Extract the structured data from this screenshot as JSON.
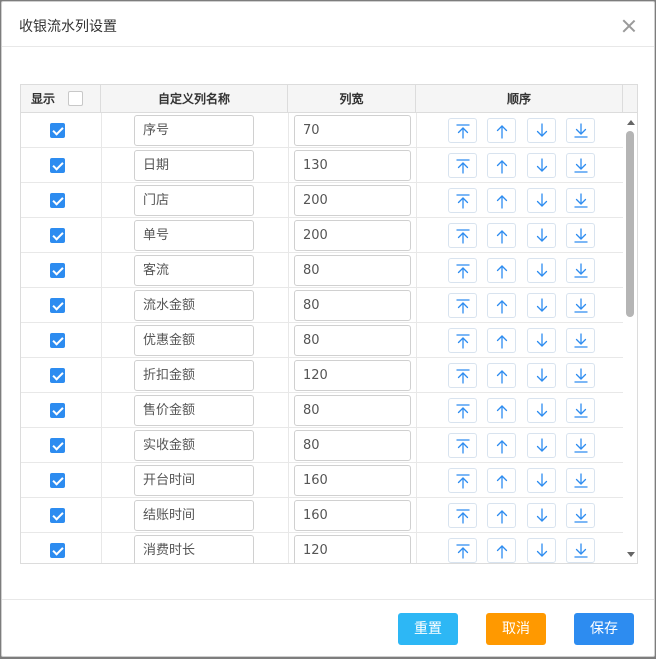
{
  "dialog": {
    "title": "收银流水列设置"
  },
  "table": {
    "headers": {
      "show": "显示",
      "name": "自定义列名称",
      "width": "列宽",
      "order": "顺序"
    },
    "rows": [
      {
        "checked": true,
        "name": "序号",
        "width": "70"
      },
      {
        "checked": true,
        "name": "日期",
        "width": "130"
      },
      {
        "checked": true,
        "name": "门店",
        "width": "200"
      },
      {
        "checked": true,
        "name": "单号",
        "width": "200"
      },
      {
        "checked": true,
        "name": "客流",
        "width": "80"
      },
      {
        "checked": true,
        "name": "流水金额",
        "width": "80"
      },
      {
        "checked": true,
        "name": "优惠金额",
        "width": "80"
      },
      {
        "checked": true,
        "name": "折扣金额",
        "width": "120"
      },
      {
        "checked": true,
        "name": "售价金额",
        "width": "80"
      },
      {
        "checked": true,
        "name": "实收金额",
        "width": "80"
      },
      {
        "checked": true,
        "name": "开台时间",
        "width": "160"
      },
      {
        "checked": true,
        "name": "结账时间",
        "width": "160"
      },
      {
        "checked": true,
        "name": "消费时长",
        "width": "120"
      }
    ],
    "order_icons": [
      "move-top-icon",
      "move-up-icon",
      "move-down-icon",
      "move-bottom-icon"
    ]
  },
  "footer": {
    "reset_label": "重置",
    "cancel_label": "取消",
    "save_label": "保存"
  },
  "colors": {
    "accent": "#2d8cf0",
    "reset": "#2db7f5",
    "cancel": "#ff9900",
    "save": "#2d8cf0",
    "icon": "#2d8cf0"
  }
}
